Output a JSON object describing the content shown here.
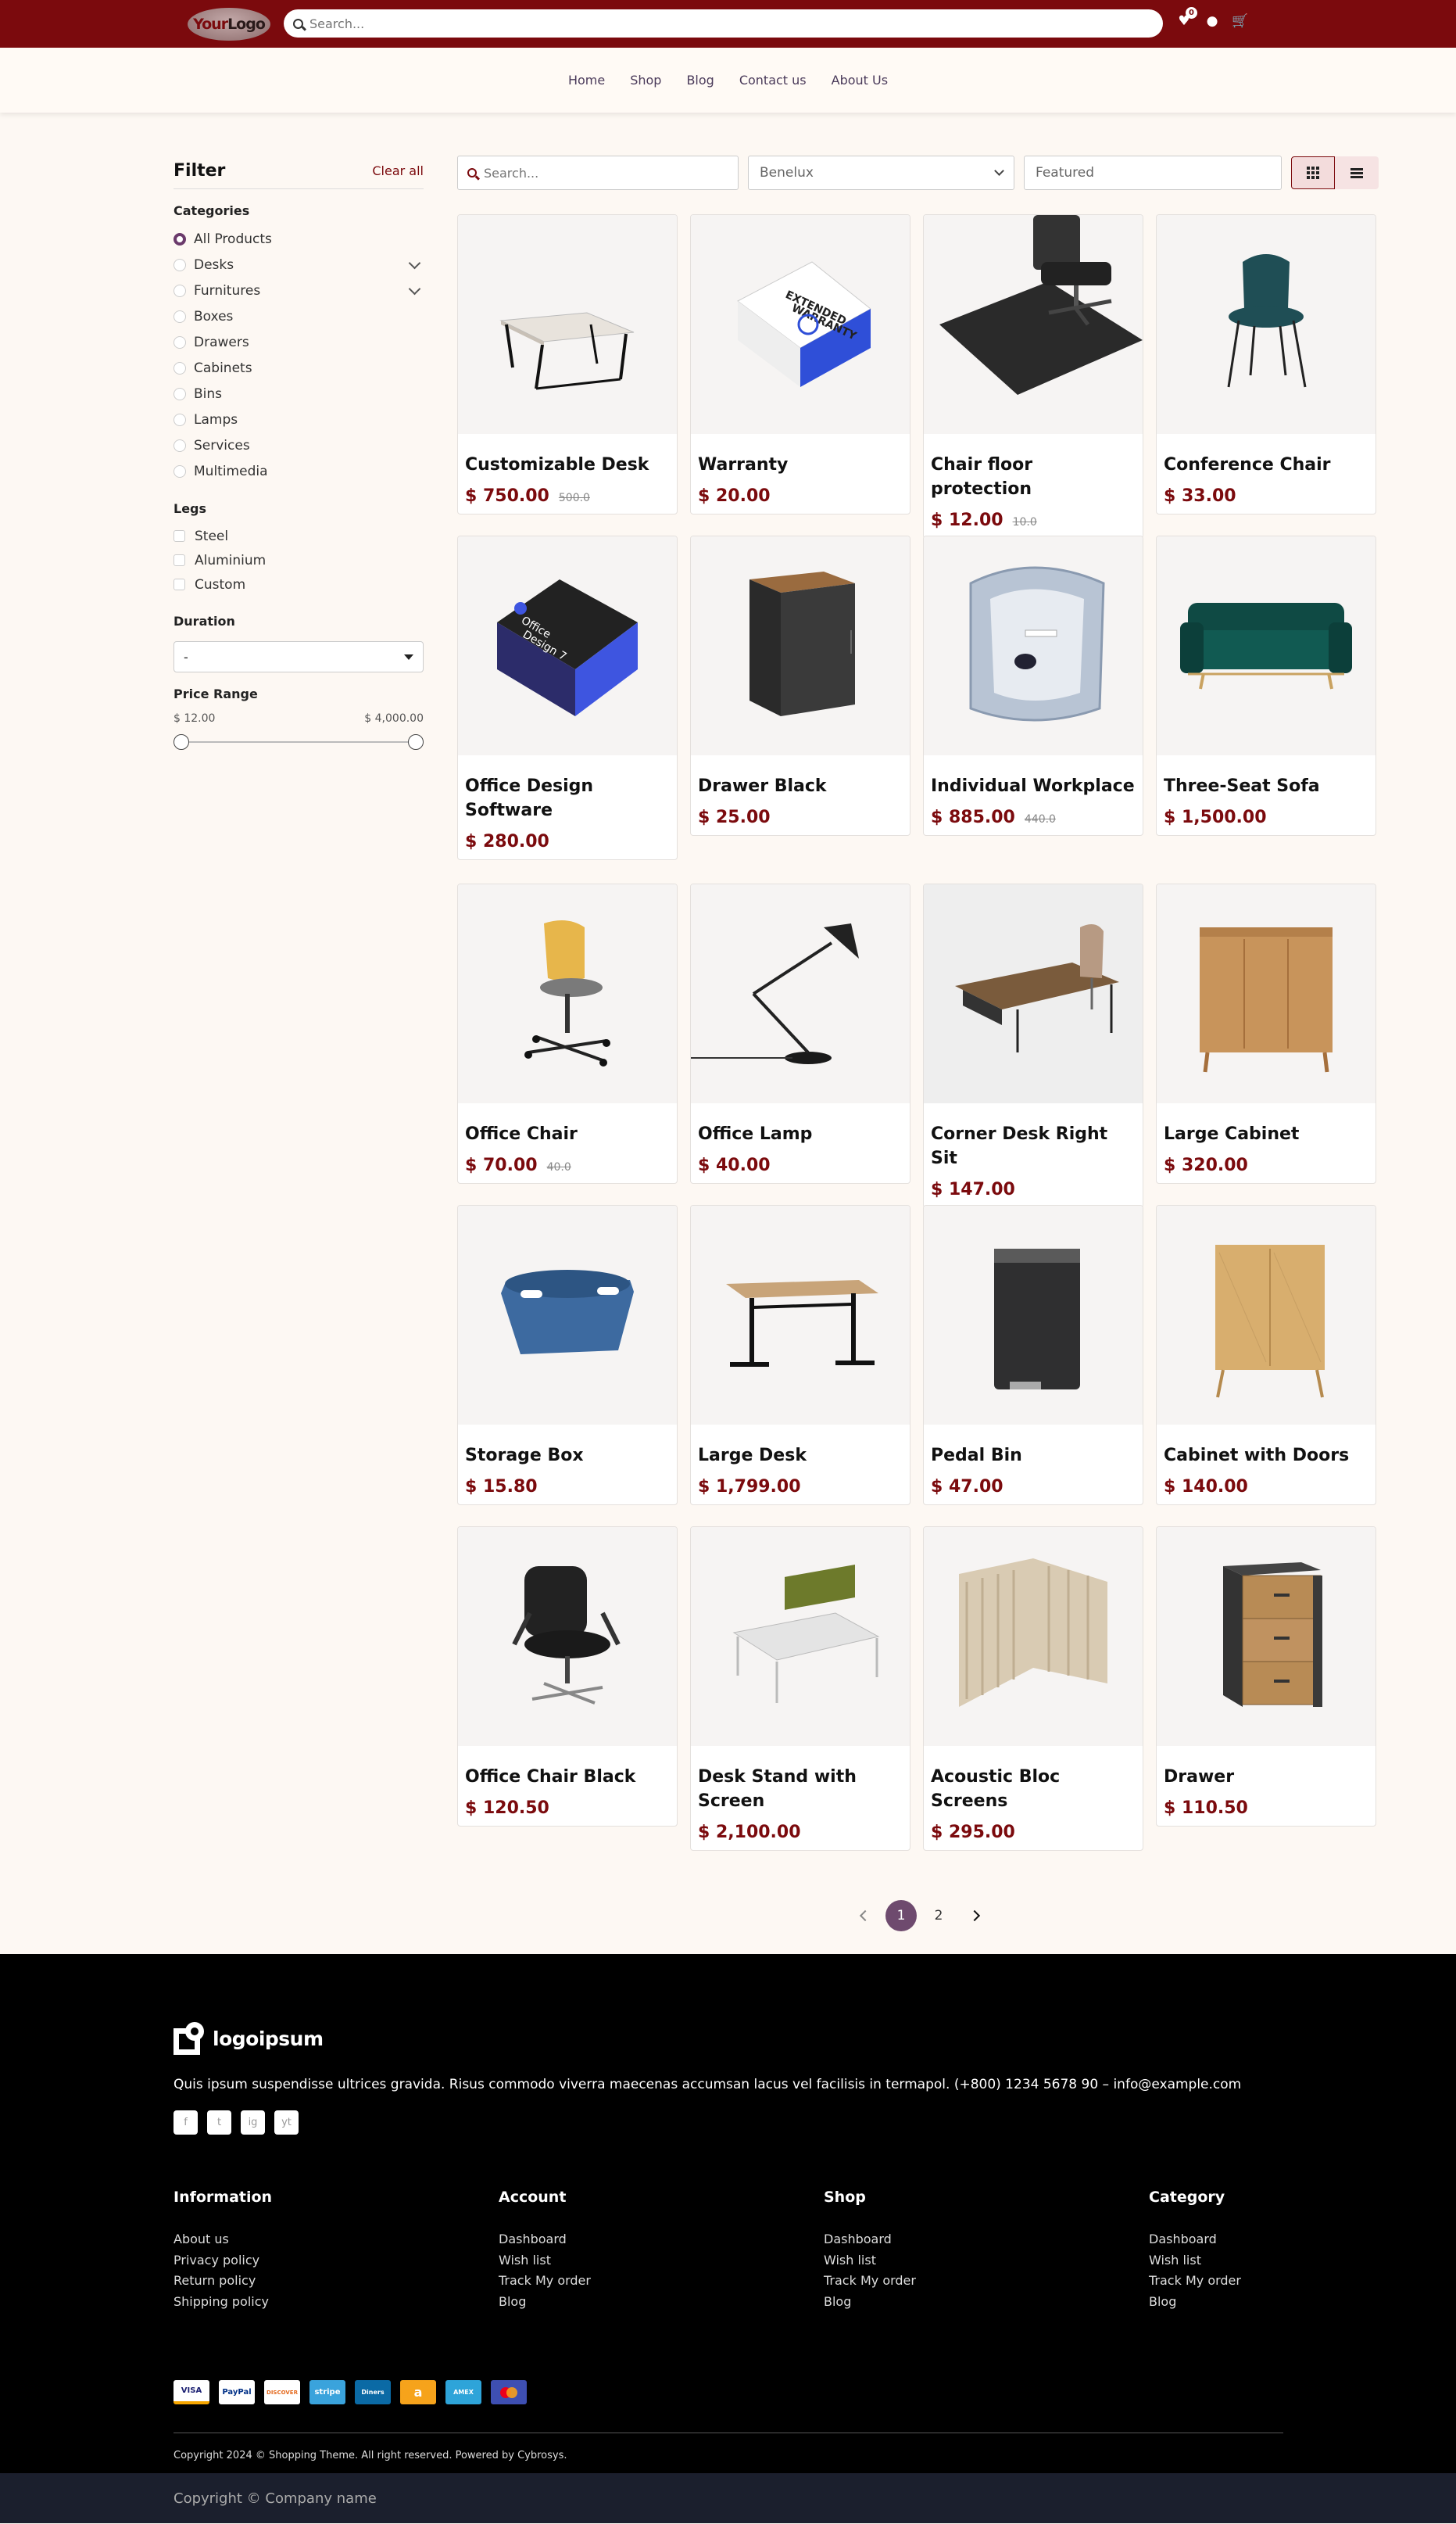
{
  "header": {
    "logo": {
      "part1": "Your",
      "part2": "Logo"
    },
    "search_placeholder": "Search...",
    "wishlist_count": "0"
  },
  "nav": [
    "Home",
    "Shop",
    "Blog",
    "Contact us",
    "About Us"
  ],
  "sidebar": {
    "title": "Filter",
    "clear_all": "Clear all",
    "categories_title": "Categories",
    "categories": [
      "All Products",
      "Desks",
      "Furnitures",
      "Boxes",
      "Drawers",
      "Cabinets",
      "Bins",
      "Lamps",
      "Services",
      "Multimedia"
    ],
    "legs_title": "Legs",
    "legs": [
      "Steel",
      "Aluminium",
      "Custom"
    ],
    "duration_title": "Duration",
    "duration_value": "-",
    "price_title": "Price Range",
    "price_min": "$ 12.00",
    "price_max": "$ 4,000.00"
  },
  "toolbar": {
    "search_placeholder": "Search...",
    "pricelist": "Benelux",
    "sort_placeholder": "Featured"
  },
  "products": [
    {
      "name": "Customizable Desk",
      "price": "$ 750.00",
      "old": "500.0",
      "img": "desk-white"
    },
    {
      "name": "Warranty",
      "price": "$ 20.00",
      "old": "",
      "img": "warranty-box"
    },
    {
      "name": "Chair floor protection",
      "price": "$ 12.00",
      "old": "10.0",
      "img": "floor-mat"
    },
    {
      "name": "Conference Chair",
      "price": "$ 33.00",
      "old": "",
      "img": "teal-chair"
    },
    {
      "name": "Office Design Software",
      "price": "$ 280.00",
      "old": "",
      "img": "software-box"
    },
    {
      "name": "Drawer Black",
      "price": "$ 25.00",
      "old": "",
      "img": "black-drawer"
    },
    {
      "name": "Individual Workplace",
      "price": "$ 885.00",
      "old": "440.0",
      "img": "pod"
    },
    {
      "name": "Three-Seat Sofa",
      "price": "$ 1,500.00",
      "old": "",
      "img": "sofa"
    },
    {
      "name": "Office Chair",
      "price": "$ 70.00",
      "old": "40.0",
      "img": "yellow-chair"
    },
    {
      "name": "Office Lamp",
      "price": "$ 40.00",
      "old": "",
      "img": "lamp"
    },
    {
      "name": "Corner Desk Right Sit",
      "price": "$ 147.00",
      "old": "",
      "img": "corner-desk"
    },
    {
      "name": "Large Cabinet",
      "price": "$ 320.00",
      "old": "",
      "img": "large-cabinet"
    },
    {
      "name": "Storage Box",
      "price": "$ 15.80",
      "old": "",
      "img": "storage-box"
    },
    {
      "name": "Large Desk",
      "price": "$ 1,799.00",
      "old": "",
      "img": "large-desk"
    },
    {
      "name": "Pedal Bin",
      "price": "$ 47.00",
      "old": "",
      "img": "pedal-bin"
    },
    {
      "name": "Cabinet with Doors",
      "price": "$ 140.00",
      "old": "",
      "img": "door-cabinet"
    },
    {
      "name": "Office Chair Black",
      "price": "$ 120.50",
      "old": "",
      "img": "black-chair"
    },
    {
      "name": "Desk Stand with Screen",
      "price": "$ 2,100.00",
      "old": "",
      "img": "desk-screen"
    },
    {
      "name": "Acoustic Bloc Screens",
      "price": "$ 295.00",
      "old": "",
      "img": "acoustic-screens"
    },
    {
      "name": "Drawer",
      "price": "$ 110.50",
      "old": "",
      "img": "wood-drawer"
    }
  ],
  "pagination": {
    "pages": [
      "1",
      "2"
    ],
    "active": "1"
  },
  "footer": {
    "logo_text": "logoipsum",
    "description": "Quis ipsum suspendisse ultrices gravida. Risus commodo viverra maecenas accumsan lacus vel facilisis in termapol. (+800) 1234 5678 90 – info@example.com",
    "social": [
      "f",
      "t",
      "ig",
      "yt"
    ],
    "columns": [
      {
        "title": "Information",
        "links": [
          "About us",
          "Privacy policy",
          "Return policy",
          "Shipping policy"
        ]
      },
      {
        "title": "Account",
        "links": [
          "Dashboard",
          "Wish list",
          "Track My order",
          "Blog"
        ]
      },
      {
        "title": "Shop",
        "links": [
          "Dashboard",
          "Wish list",
          "Track My order",
          "Blog"
        ]
      },
      {
        "title": "Category",
        "links": [
          "Dashboard",
          "Wish list",
          "Track My order",
          "Blog"
        ]
      }
    ],
    "payments": [
      "VISA",
      "PayPal",
      "DISCOVER",
      "stripe",
      "Diners",
      "a",
      "AMEX",
      "MC"
    ],
    "copyright_small": "Copyright 2024 © Shopping Theme. All right reserved. Powered by Cybrosys.",
    "copyright_bottom": "Copyright © Company name"
  },
  "colors": {
    "brand": "#7b0a0d",
    "accent": "#6e4a6e",
    "footer_bg": "#000000",
    "bottom_bar": "#1b1f2d"
  }
}
